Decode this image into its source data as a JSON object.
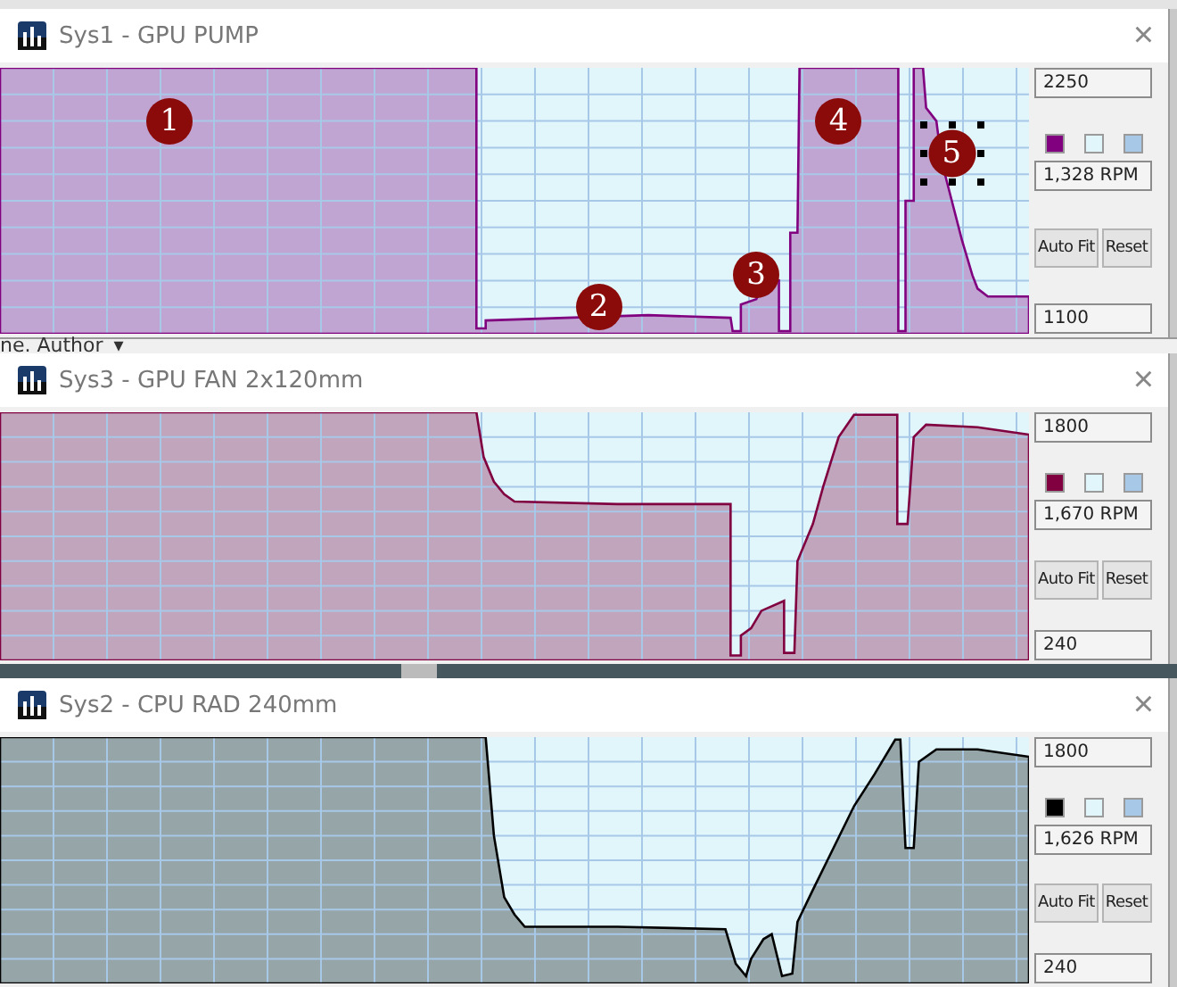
{
  "behind_text": {
    "label": "ne. Author",
    "caret": "▾"
  },
  "windows": [
    {
      "title": "Sys1 - GPU PUMP",
      "close": "×",
      "max": "2250",
      "min": "1100",
      "reading": "1,328 RPM",
      "buttons": [
        "Auto Fit",
        "Reset"
      ],
      "swatches": [
        {
          "color": "#800080"
        },
        {
          "color": "#e0f6fb"
        },
        {
          "color": "#a8c8e8"
        }
      ],
      "markers": [
        {
          "label": "1",
          "selected": false
        },
        {
          "label": "2",
          "selected": false
        },
        {
          "label": "3",
          "selected": false
        },
        {
          "label": "4",
          "selected": false
        },
        {
          "label": "5",
          "selected": true
        }
      ]
    },
    {
      "title": "Sys3 - GPU FAN 2x120mm",
      "close": "×",
      "max": "1800",
      "min": "240",
      "reading": "1,670 RPM",
      "buttons": [
        "Auto Fit",
        "Reset"
      ],
      "swatches": [
        {
          "color": "#800040"
        },
        {
          "color": "#e0f6fb"
        },
        {
          "color": "#a8c8e8"
        }
      ]
    },
    {
      "title": "Sys2 - CPU RAD 240mm",
      "close": "×",
      "max": "1800",
      "min": "240",
      "reading": "1,626 RPM",
      "buttons": [
        "Auto Fit",
        "Reset"
      ],
      "swatches": [
        {
          "color": "#000000"
        },
        {
          "color": "#e0f6fb"
        },
        {
          "color": "#a8c8e8"
        }
      ]
    }
  ]
}
